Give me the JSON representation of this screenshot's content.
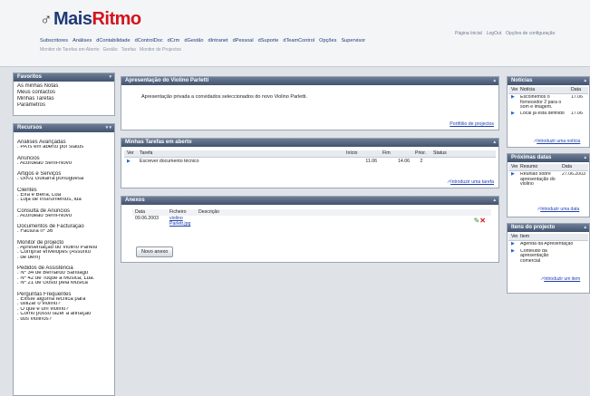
{
  "header": {
    "logo_left": "Mais",
    "logo_right": "Ritmo",
    "mainnav": [
      "Subscritores",
      "Análises",
      "dContabilidade",
      "dControlDoc",
      "dCrm",
      "dGestão",
      "dIntranet",
      "dPessoal",
      "dSuporte",
      "dTeamControl",
      "Opções",
      "Supervisor"
    ],
    "subnav": [
      "Monitor de Tarefas em Aberto",
      "Gestão",
      "Tarefas",
      "Monitor de Projectos"
    ],
    "toplinks": [
      "Página Inicial",
      "LogOut",
      "Opções de configuração"
    ]
  },
  "shortcuts": {
    "title": "Favoritos",
    "items": [
      "As minhas Notas",
      "Meus contactos",
      "Minhas Tarefas",
      "Parâmetros"
    ]
  },
  "resources": {
    "title": "Recursos",
    "groups": [
      {
        "head": "Análises Avançadas",
        "lines": [
          ". PATs em aberto por status"
        ]
      },
      {
        "head": "Anúncios",
        "lines": [
          ". Acordeão Semi-Novo"
        ]
      },
      {
        "head": "Artigos e Serviços",
        "lines": [
          ". G001 Guitarra portuguesa"
        ]
      },
      {
        "head": "Clientes",
        "lines": [
          ". Eira e Beira, Lda",
          ". Loja de Instrumentos, lda"
        ]
      },
      {
        "head": "Consulta de Anúncios",
        "lines": [
          ". Acordeão Semi-Novo"
        ]
      },
      {
        "head": "Documentos de Facturação",
        "lines": [
          ". Factura nº 36"
        ]
      },
      {
        "head": "Monitor de projecto",
        "lines": [
          ". Apresentação do Violino Parletti",
          ". Comprar envelopes (Assunto",
          ". de dem)"
        ]
      },
      {
        "head": "Pedidos de Assistência",
        "lines": [
          ". Nº 34 de Bernardo Santiago",
          ". Nº 42 de Toque a Música, Lda.",
          ". Nº 21 de Gosto pela Música"
        ]
      },
      {
        "head": "Perguntas Frequentes",
        "lines": [
          ". Existe alguma técnica para",
          ". utilizar o violino?",
          ". O que é um violino?",
          ". Como posso fazer a afinação",
          ". dos violinos?"
        ]
      }
    ]
  },
  "project": {
    "title": "Apresentação do Violino Parletti",
    "desc": "Apresentação privada a convidados seleccionados do novo Violino Parletti.",
    "link": "Portfólio de projectos"
  },
  "tasks": {
    "title": "Minhas Tarefas em aberto",
    "headers": [
      "Ver",
      "Tarefa",
      "Início",
      "Fim",
      "Prior.",
      "Status"
    ],
    "rows": [
      {
        "task": "Escrever documento técnico",
        "start": "11.06",
        "end": "14.06",
        "prio": "2",
        "status": ""
      }
    ],
    "link": "Introduzir uma tarefa"
  },
  "attachments": {
    "title": "Anexos",
    "headers": [
      "Data",
      "Ficheiro",
      "Descrição"
    ],
    "rows": [
      {
        "date": "09.06.2003",
        "files": [
          "violino",
          "Parlett.jpg"
        ],
        "desc": ""
      }
    ],
    "button": "Novo anexo"
  },
  "news": {
    "title": "Notícias",
    "headers": [
      "Ver",
      "Notícia",
      "Data"
    ],
    "rows": [
      {
        "text": "Escolhemos o fornecedor 2 para o som e imagem.",
        "date": "17.06"
      },
      {
        "text": "Local já está definido",
        "date": "17.06"
      }
    ],
    "link": "Introduzir uma notícia"
  },
  "dates": {
    "title": "Próximas datas",
    "headers": [
      "Ver",
      "Resumo",
      "Data"
    ],
    "rows": [
      {
        "text": "Reunião sobre apresentação do violino",
        "date": "27.06.2003"
      }
    ],
    "link": "Introduzir uma data"
  },
  "items": {
    "title": "Itens do projecto",
    "headers": [
      "Ver",
      "Item"
    ],
    "rows": [
      {
        "text": "Agenda da Apresentação"
      },
      {
        "text": "Conteúdo da apresentação comercial"
      }
    ],
    "link": "Introduzir um item"
  }
}
